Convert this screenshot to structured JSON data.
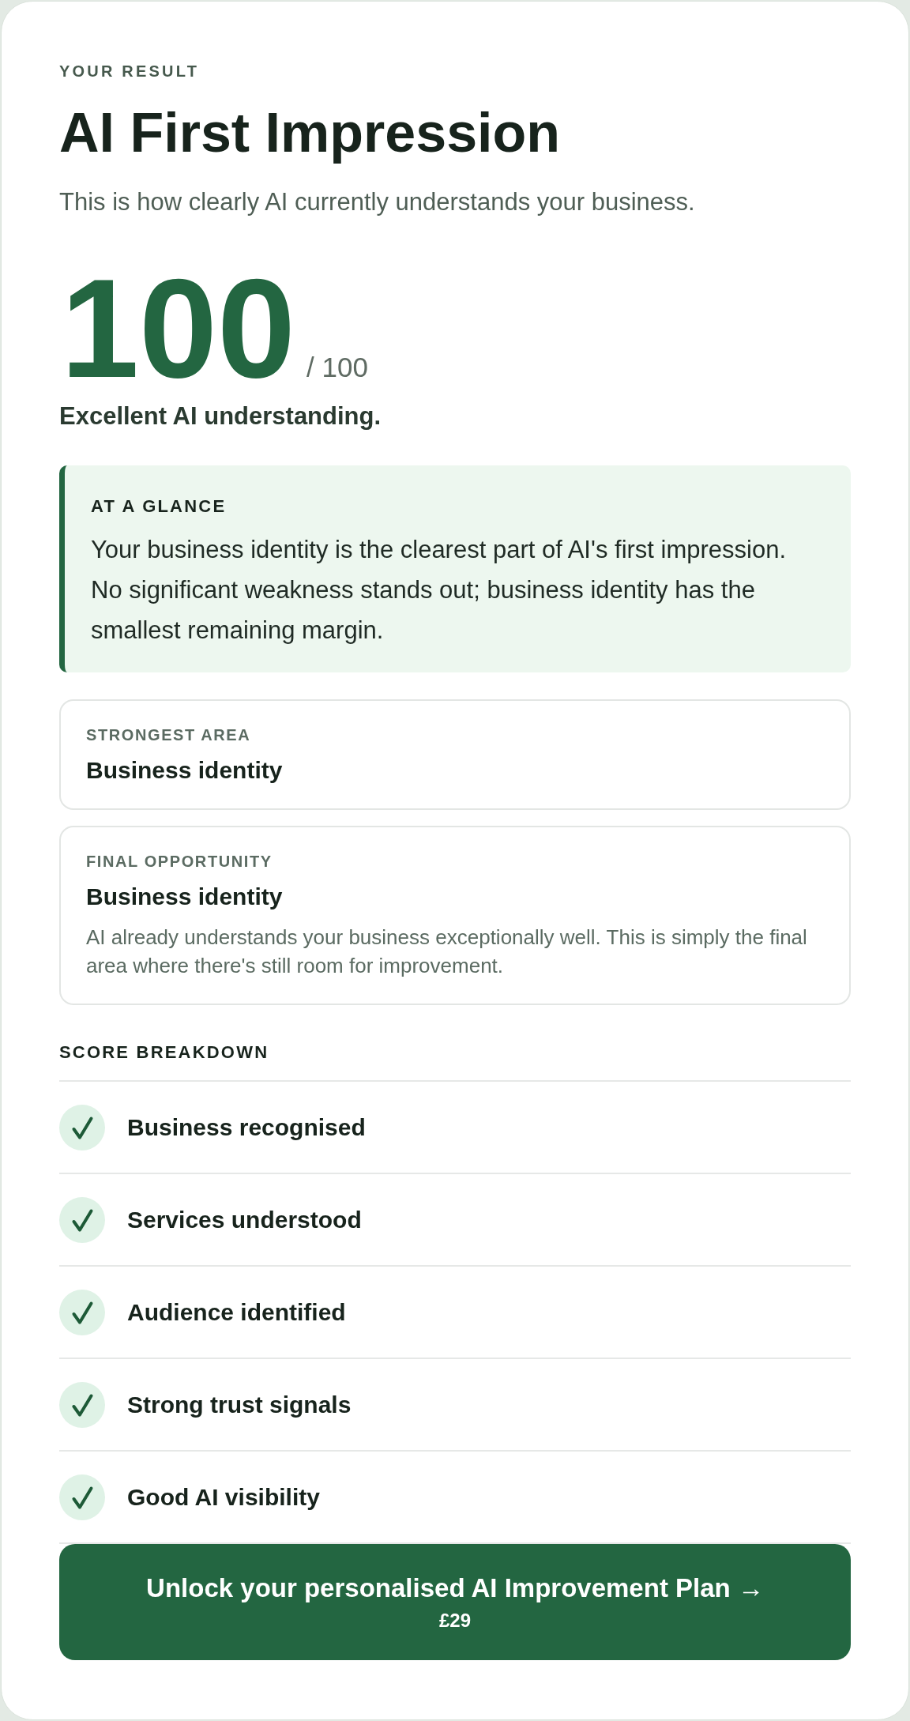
{
  "header": {
    "eyebrow": "YOUR RESULT",
    "title": "AI First Impression",
    "subtitle": "This is how clearly AI currently understands your business."
  },
  "score": {
    "value": "100",
    "max": "/ 100",
    "verdict": "Excellent AI understanding."
  },
  "at_a_glance": {
    "heading": "AT A GLANCE",
    "text": "Your business identity is the clearest part of AI's first impression. No significant weakness stands out; business identity has the smallest remaining margin."
  },
  "cards": [
    {
      "label": "STRONGEST AREA",
      "value": "Business identity"
    },
    {
      "label": "FINAL OPPORTUNITY",
      "value": "Business identity",
      "description": "AI already understands your business exceptionally well. This is simply the final area where there's still room for improvement."
    }
  ],
  "breakdown": {
    "heading": "SCORE BREAKDOWN",
    "items": [
      {
        "label": "Business recognised",
        "checked": true
      },
      {
        "label": "Services understood",
        "checked": true
      },
      {
        "label": "Audience identified",
        "checked": true
      },
      {
        "label": "Strong trust signals",
        "checked": true
      },
      {
        "label": "Good AI visibility",
        "checked": true
      }
    ]
  },
  "cta": {
    "label": "Unlock your personalised AI Improvement Plan →",
    "price": "£29"
  }
}
